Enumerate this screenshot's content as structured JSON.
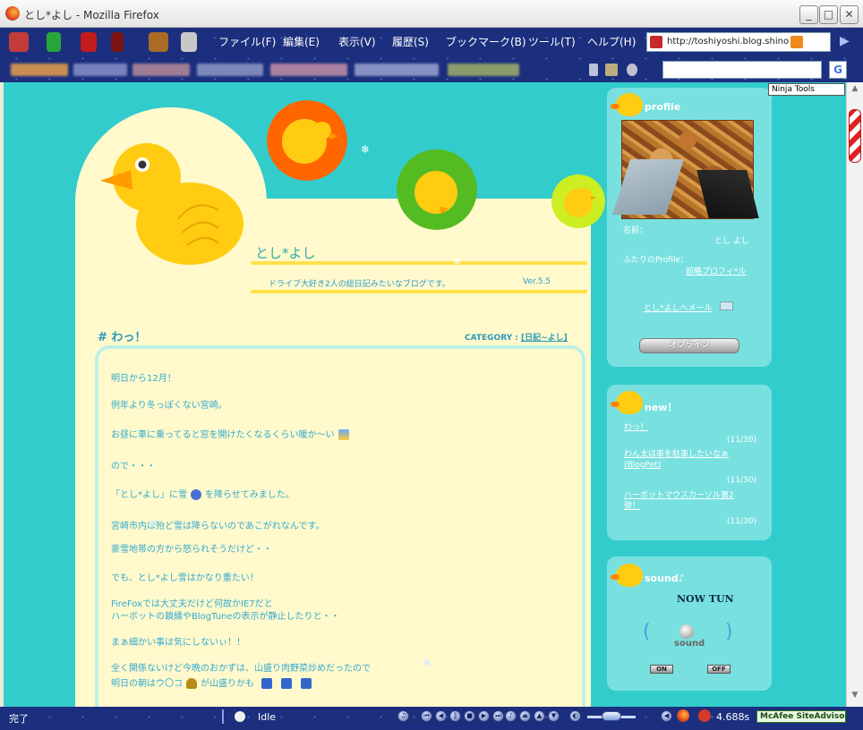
{
  "window": {
    "title": "とし*よし - Mozilla Firefox"
  },
  "menu": [
    "ファイル(F)",
    "編集(E)",
    "表示(V)",
    "履歴(S)",
    "ブックマーク(B)",
    "ツール(T)",
    "ヘルプ(H)"
  ],
  "address_bar": {
    "url": "http://toshiyoshi.blog.shino"
  },
  "ninja_tools": "Ninja Tools",
  "blog": {
    "title": "とし*よし",
    "subtitle": "ドライブ大好き2人の総日記みたいなブログです。",
    "version": "Ver.5.5"
  },
  "post": {
    "title": "# わっ！",
    "category_label": "CATEGORY :",
    "category_link": "[日記~よし]",
    "lines": [
      "明日から12月！",
      "例年より冬っぽくない宮崎。",
      "お昼に車に乗ってると窓を開けたくなるくらい暖か〜い",
      "ので・・・",
      "「とし*よし」に雪",
      "を降らせてみました。",
      "宮崎市内は殆ど雪は降らないのであこがれなんです。",
      "豪雪地帯の方から怒られそうだけど・・",
      "でも、とし*よし雪はかなり重たい！",
      "FireFoxでは大丈夫だけど何故かIE7だと",
      "ハーボットの鎖縁やBlogTuneの表示が静止したりと・・",
      "まぁ細かい事は気にしないぃ！！",
      "全く関係ないけど今晩のおかずは、山盛り肉野菜炒めだったので",
      "明日の朝はウ〇コ",
      "が山盛りかも"
    ]
  },
  "sidebar": {
    "profile": {
      "heading": "profile",
      "name_label": "名前：",
      "name_value": "とし よし",
      "intro_label": "ふたりのProfile：",
      "intro_link": "前略プロフィ*ル",
      "mail_link": "とし*よしへメール",
      "offline_button": "オフライン"
    },
    "new": {
      "heading": "new！",
      "entries": [
        {
          "title": "わっ！",
          "date": "(11/30)"
        },
        {
          "title": "わん太は車を駐車したいなぁ(BlogPet)",
          "date": "(11/30)"
        },
        {
          "title": "ハーボットマウスカーソル第2弾！",
          "date": "(11/30)"
        }
      ]
    },
    "sound": {
      "heading": "sound♪",
      "now_tun": "NOW TUN",
      "knob_label": "sound",
      "on": "ON",
      "off": "OFF"
    }
  },
  "statusbar": {
    "status": "完了",
    "player_state": "Idle",
    "time": "4.688s",
    "mcafee": "McAfee SiteAdvisor"
  },
  "colors": {
    "content_bg": "#33cccc",
    "cream": "#fff9cc",
    "navbar": "#1b2f7e",
    "sidebar_panel": "#79e0e0",
    "post_text": "#33aad0",
    "duck_yellow": "#ffcc11"
  }
}
